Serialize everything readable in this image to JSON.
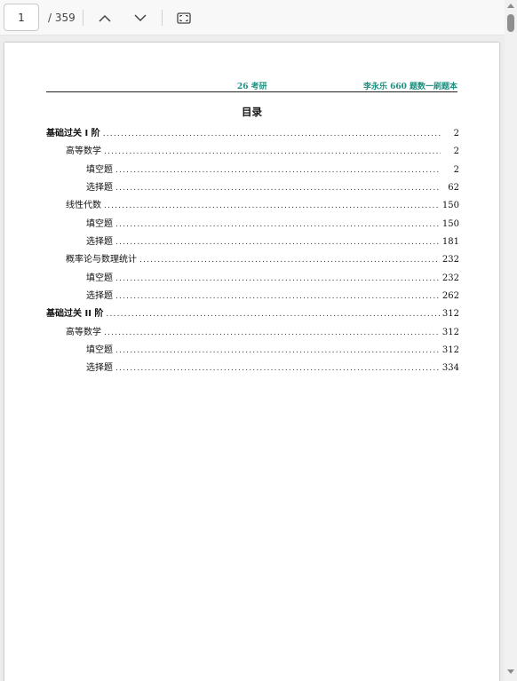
{
  "toolbar": {
    "page_value": "1",
    "page_total": "/ 359",
    "prev_icon": "chevron-up-icon",
    "next_icon": "chevron-down-icon",
    "fit_icon": "fit-page-icon"
  },
  "document": {
    "header_left": "26 考研",
    "header_right": "李永乐 660 题数一刷题本",
    "header_color": "#1e8f80",
    "toc_title": "目录",
    "toc": [
      {
        "label": "基础过关 I 阶",
        "page": "2"
      },
      {
        "label": "高等数学",
        "page": "2"
      },
      {
        "label": "填空题",
        "page": "2"
      },
      {
        "label": "选择题",
        "page": "62"
      },
      {
        "label": "线性代数",
        "page": "150"
      },
      {
        "label": "填空题",
        "page": "150"
      },
      {
        "label": "选择题",
        "page": "181"
      },
      {
        "label": "概率论与数理统计",
        "page": "232"
      },
      {
        "label": "填空题",
        "page": "232"
      },
      {
        "label": "选择题",
        "page": "262"
      },
      {
        "label": "基础过关 II 阶",
        "page": "312"
      },
      {
        "label": "高等数学",
        "page": "312"
      },
      {
        "label": "填空题",
        "page": "312"
      },
      {
        "label": "选择题",
        "page": "334"
      }
    ]
  }
}
